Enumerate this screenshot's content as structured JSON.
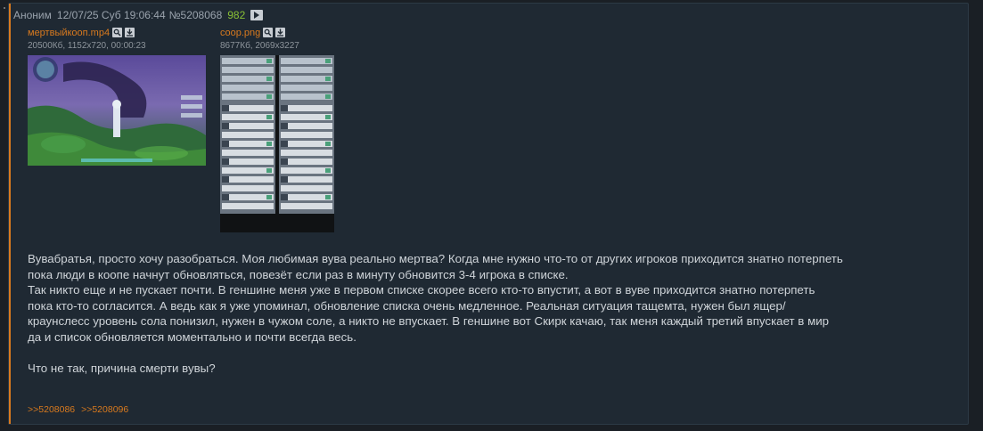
{
  "post": {
    "author": "Аноним",
    "date": "12/07/25 Суб 19:06:44",
    "number": "№5208068",
    "position": "982",
    "play_icon": "play-icon"
  },
  "files": [
    {
      "name": "мертвыйкооп.mp4",
      "info": "20500Кб, 1152x720, 00:00:23",
      "search_icon": "search-icon",
      "download_icon": "download-icon"
    },
    {
      "name": "coop.png",
      "info": "8677Кб, 2069x3227",
      "search_icon": "search-icon",
      "download_icon": "download-icon"
    }
  ],
  "body": {
    "lines": [
      "Вувабратья, просто хочу разобраться. Моя любимая вува реально мертва? Когда мне нужно что-то от других игроков приходится знатно потерпеть",
      "пока люди в коопе начнут обновляться, повезёт если раз в минуту обновится 3-4 игрока в списке.",
      "Так никто еще и не пускает почти. В геншине меня уже в первом списке скорее всего кто-то впустит, а вот в вуве приходится знатно потерпеть",
      "пока кто-то согласится. А ведь как я уже упоминал, обновление списка очень медленное. Реальная ситуация тащемта, нужен был ящер/",
      "краунслесс уровень сола понизил, нужен в чужом соле, а никто не впускает. В геншине вот Скирк качаю, так меня каждый третий впускает в мир",
      "да и список обновляется моментально и почти всегда весь."
    ],
    "question": "Что не так, причина смерти вувы?"
  },
  "replies": [
    ">>5208086",
    ">>5208096"
  ],
  "colors": {
    "accent": "#d97a1e",
    "position": "#88c035",
    "post_bg": "#1f2933",
    "page_bg": "#1a1f25"
  }
}
